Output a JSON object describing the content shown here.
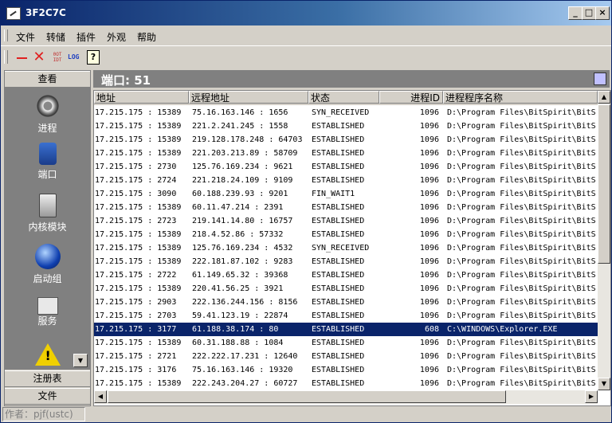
{
  "window": {
    "title": "3F2C7C"
  },
  "title_buttons": [
    "_",
    "□",
    "×"
  ],
  "menu": [
    "文件",
    "转储",
    "插件",
    "外观",
    "帮助"
  ],
  "toolbar": {
    "ot_label": "0OT\nIDT",
    "log_label": "LOG",
    "help_label": "?"
  },
  "sidebar": {
    "top_header": "查看",
    "items": [
      {
        "label": "进程",
        "icon": "gear-icon"
      },
      {
        "label": "端口",
        "icon": "plug-icon"
      },
      {
        "label": "内核模块",
        "icon": "disk-icon"
      },
      {
        "label": "启动组",
        "icon": "globe-icon"
      },
      {
        "label": "服务",
        "icon": "pc-icon"
      },
      {
        "label": "",
        "icon": "warning-icon"
      }
    ],
    "bottom_headers": [
      "注册表",
      "文件"
    ]
  },
  "panel": {
    "title": "端口: 51"
  },
  "table": {
    "headers": [
      "地址",
      "远程地址",
      "状态",
      "进程ID",
      "进程程序名称"
    ],
    "rows": [
      [
        "17.215.175 : 15389",
        "75.16.163.146 : 1656",
        "SYN_RECEIVED",
        "1096",
        "D:\\Program Files\\BitSpirit\\BitS"
      ],
      [
        "17.215.175 : 15389",
        "221.2.241.245 : 1558",
        "ESTABLISHED",
        "1096",
        "D:\\Program Files\\BitSpirit\\BitS"
      ],
      [
        "17.215.175 : 15389",
        "219.128.178.248 : 64703",
        "ESTABLISHED",
        "1096",
        "D:\\Program Files\\BitSpirit\\BitS"
      ],
      [
        "17.215.175 : 15389",
        "221.203.213.89 : 58709",
        "ESTABLISHED",
        "1096",
        "D:\\Program Files\\BitSpirit\\BitS"
      ],
      [
        "17.215.175 : 2730",
        "125.76.169.234 : 9621",
        "ESTABLISHED",
        "1096",
        "D:\\Program Files\\BitSpirit\\BitS"
      ],
      [
        "17.215.175 : 2724",
        "221.218.24.109 : 9109",
        "ESTABLISHED",
        "1096",
        "D:\\Program Files\\BitSpirit\\BitS"
      ],
      [
        "17.215.175 : 3090",
        "60.188.239.93 : 9201",
        "FIN_WAIT1",
        "1096",
        "D:\\Program Files\\BitSpirit\\BitS"
      ],
      [
        "17.215.175 : 15389",
        "60.11.47.214 : 2391",
        "ESTABLISHED",
        "1096",
        "D:\\Program Files\\BitSpirit\\BitS"
      ],
      [
        "17.215.175 : 2723",
        "219.141.14.80 : 16757",
        "ESTABLISHED",
        "1096",
        "D:\\Program Files\\BitSpirit\\BitS"
      ],
      [
        "17.215.175 : 15389",
        "218.4.52.86 : 57332",
        "ESTABLISHED",
        "1096",
        "D:\\Program Files\\BitSpirit\\BitS"
      ],
      [
        "17.215.175 : 15389",
        "125.76.169.234 : 4532",
        "SYN_RECEIVED",
        "1096",
        "D:\\Program Files\\BitSpirit\\BitS"
      ],
      [
        "17.215.175 : 15389",
        "222.181.87.102 : 9283",
        "ESTABLISHED",
        "1096",
        "D:\\Program Files\\BitSpirit\\BitS"
      ],
      [
        "17.215.175 : 2722",
        "61.149.65.32 : 39368",
        "ESTABLISHED",
        "1096",
        "D:\\Program Files\\BitSpirit\\BitS"
      ],
      [
        "17.215.175 : 15389",
        "220.41.56.25 : 3921",
        "ESTABLISHED",
        "1096",
        "D:\\Program Files\\BitSpirit\\BitS"
      ],
      [
        "17.215.175 : 2903",
        "222.136.244.156 : 8156",
        "ESTABLISHED",
        "1096",
        "D:\\Program Files\\BitSpirit\\BitS"
      ],
      [
        "17.215.175 : 2703",
        "59.41.123.19 : 22874",
        "ESTABLISHED",
        "1096",
        "D:\\Program Files\\BitSpirit\\BitS"
      ],
      [
        "17.215.175 : 3177",
        "61.188.38.174 : 80",
        "ESTABLISHED",
        "608",
        "C:\\WINDOWS\\Explorer.EXE"
      ],
      [
        "17.215.175 : 15389",
        "60.31.188.88 : 1084",
        "ESTABLISHED",
        "1096",
        "D:\\Program Files\\BitSpirit\\BitS"
      ],
      [
        "17.215.175 : 2721",
        "222.222.17.231 : 12640",
        "ESTABLISHED",
        "1096",
        "D:\\Program Files\\BitSpirit\\BitS"
      ],
      [
        "17.215.175 : 3176",
        "75.16.163.146 : 19320",
        "ESTABLISHED",
        "1096",
        "D:\\Program Files\\BitSpirit\\BitS"
      ],
      [
        "17.215.175 : 15389",
        "222.243.204.27 : 60727",
        "ESTABLISHED",
        "1096",
        "D:\\Program Files\\BitSpirit\\BitS"
      ]
    ],
    "selected_row": 16
  },
  "status": {
    "text": "作者：pjf(ustc)"
  },
  "colors": {
    "selection": "#0a246a",
    "title_start": "#0a246a",
    "title_end": "#a6caf0"
  }
}
